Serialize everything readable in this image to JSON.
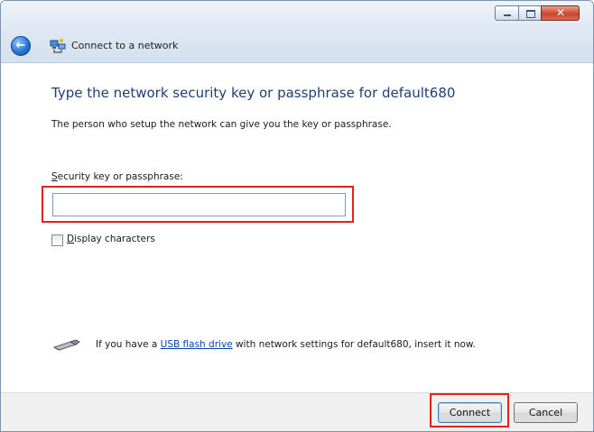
{
  "window": {
    "title": "Connect to a network",
    "controls": {
      "minimize_icon": "minimize-icon",
      "maximize_icon": "maximize-icon",
      "close_glyph": "✕"
    }
  },
  "content": {
    "heading": "Type the network security key or passphrase for default680",
    "subtext": "The person who setup the network can give you the key or passphrase.",
    "field_label_access": "S",
    "field_label_rest": "ecurity key or passphrase:",
    "key_input_value": "",
    "display_chars_access": "D",
    "display_chars_rest": "isplay characters",
    "usb_prefix": "If you have a ",
    "usb_link": "USB flash drive",
    "usb_suffix": " with network settings for default680, insert it now."
  },
  "footer": {
    "connect_label": "Connect",
    "cancel_label": "Cancel"
  },
  "colors": {
    "heading": "#1e3f7a",
    "highlight": "#e3221d",
    "link": "#0645ad"
  }
}
